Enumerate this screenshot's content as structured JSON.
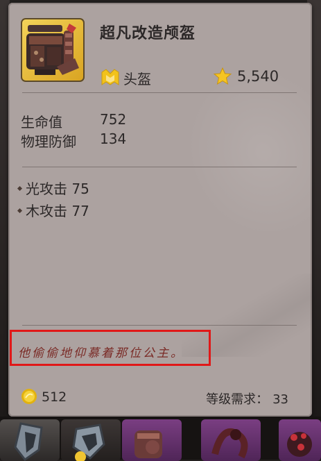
{
  "item": {
    "name": "超凡改造颅盔",
    "type": "头盔",
    "power": "5,540",
    "icon": "rusted-helmet-icon"
  },
  "stats": [
    {
      "name": "生命值",
      "value": "752"
    },
    {
      "name": "物理防御",
      "value": "134"
    }
  ],
  "bonuses": [
    {
      "label": "光攻击 75"
    },
    {
      "label": "木攻击 77"
    }
  ],
  "flavor_text": "他偷偷地仰慕着那位公主。",
  "footer": {
    "gold": "512",
    "level_label": "等级需求：",
    "level_value": "33"
  },
  "colors": {
    "card": "#aca2a0",
    "flavor": "#7a2a25",
    "highlight_box": "#e01818"
  }
}
